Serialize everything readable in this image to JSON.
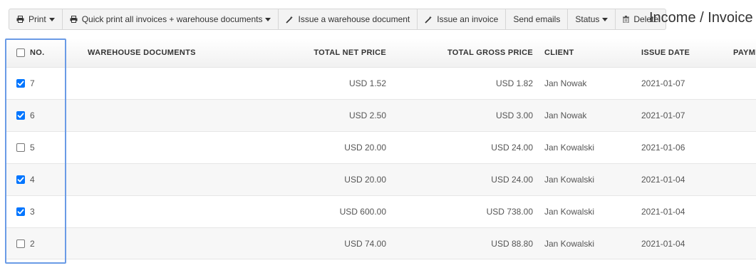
{
  "toolbar": {
    "print": "Print",
    "quick_print": "Quick print all invoices + warehouse documents",
    "issue_warehouse": "Issue a warehouse document",
    "issue_invoice": "Issue an invoice",
    "send_emails": "Send emails",
    "status": "Status",
    "delete": "Delete"
  },
  "icons": {
    "print": "printer-icon",
    "quick_print": "printer-icon",
    "issue_warehouse": "magic-wand-icon",
    "issue_invoice": "magic-wand-icon",
    "delete": "trash-icon"
  },
  "page_title": "Income / Invoice",
  "table": {
    "headers": {
      "no": "NO.",
      "warehouse_documents": "WAREHOUSE DOCUMENTS",
      "total_net_price": "TOTAL NET PRICE",
      "total_gross_price": "TOTAL GROSS PRICE",
      "client": "CLIENT",
      "issue_date": "ISSUE DATE",
      "payment": "PAYME"
    },
    "select_all_checked": false,
    "rows": [
      {
        "no": "7",
        "checked": true,
        "warehouse": "",
        "net": "USD 1.52",
        "gross": "USD 1.82",
        "client": "Jan Nowak",
        "date": "2021-01-07"
      },
      {
        "no": "6",
        "checked": true,
        "warehouse": "",
        "net": "USD 2.50",
        "gross": "USD 3.00",
        "client": "Jan Nowak",
        "date": "2021-01-07"
      },
      {
        "no": "5",
        "checked": false,
        "warehouse": "",
        "net": "USD 20.00",
        "gross": "USD 24.00",
        "client": "Jan Kowalski",
        "date": "2021-01-06"
      },
      {
        "no": "4",
        "checked": true,
        "warehouse": "",
        "net": "USD 20.00",
        "gross": "USD 24.00",
        "client": "Jan Kowalski",
        "date": "2021-01-04"
      },
      {
        "no": "3",
        "checked": true,
        "warehouse": "",
        "net": "USD 600.00",
        "gross": "USD 738.00",
        "client": "Jan Kowalski",
        "date": "2021-01-04"
      },
      {
        "no": "2",
        "checked": false,
        "warehouse": "",
        "net": "USD 74.00",
        "gross": "USD 88.80",
        "client": "Jan Kowalski",
        "date": "2021-01-04"
      }
    ]
  },
  "colors": {
    "checkbox_checked": "#0075ff",
    "highlight_border": "#6a9be6"
  }
}
